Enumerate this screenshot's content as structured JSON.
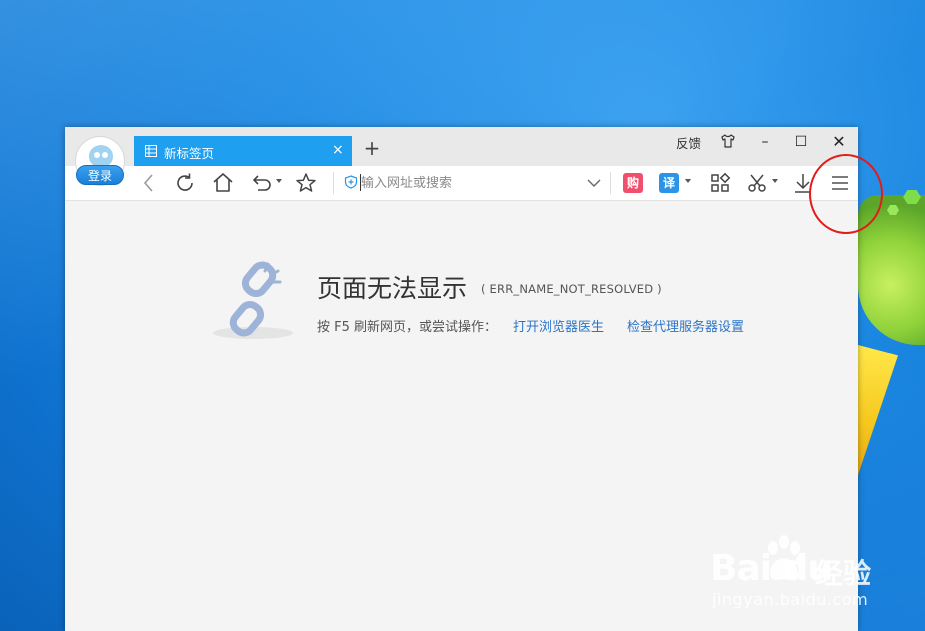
{
  "browser": {
    "tab": {
      "label": "新标签页",
      "close": "×"
    },
    "new_tab": "+",
    "window_controls": {
      "feedback": "反馈",
      "minimize": "–",
      "maximize": "☐",
      "close": "✕"
    },
    "login_label": "登录",
    "address_bar": {
      "placeholder": "输入网址或搜索",
      "value": ""
    },
    "badges": {
      "shopping": "购",
      "translate": "译"
    }
  },
  "error_page": {
    "title": "页面无法显示",
    "code": "( ERR_NAME_NOT_RESOLVED )",
    "hint": "按 F5 刷新网页，或尝试操作：",
    "link_doctor": "打开浏览器医生",
    "link_proxy": "检查代理服务器设置"
  },
  "watermark": {
    "logo": "Bai  du",
    "cn": "经验",
    "url": "jingyan.baidu.com"
  },
  "colors": {
    "tab_active": "#1e9ff0",
    "link": "#2b74c8",
    "highlight_circle": "#e21b1b",
    "shopping_badge": "#f0506e",
    "translate_badge": "#2a95e8"
  },
  "icons": [
    "back-icon",
    "refresh-icon",
    "home-icon",
    "undo-icon",
    "star-icon",
    "shield-icon",
    "dropdown-icon",
    "apps-icon",
    "scissors-icon",
    "download-icon",
    "menu-icon",
    "broken-link-icon",
    "skin-icon",
    "tab-grid-icon"
  ]
}
